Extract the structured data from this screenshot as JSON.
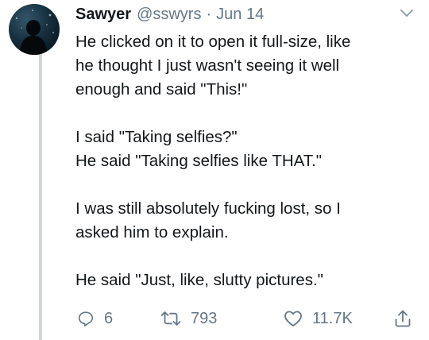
{
  "tweet": {
    "author_name": "Sawyer",
    "author_handle": "@sswyrs",
    "separator": "·",
    "date": "Jun 14",
    "paragraphs": [
      "He clicked on it to open it full-size, like\nhe thought I just wasn't seeing it well\nenough and said \"This!\"",
      "I said \"Taking selfies?\"\nHe said \"Taking selfies like THAT.\"",
      "I was still absolutely fucking lost, so I\nasked him to explain.",
      "He said \"Just, like, slutty pictures.\""
    ]
  },
  "actions": {
    "reply_count": "6",
    "retweet_count": "793",
    "like_count": "11.7K"
  },
  "icons": {
    "reply": "reply-icon",
    "retweet": "retweet-icon",
    "like": "heart-icon",
    "share": "share-icon",
    "menu": "chevron-down-icon"
  },
  "colors": {
    "text": "#14171a",
    "secondary": "#657786",
    "thread_line": "#ccd6dd"
  }
}
